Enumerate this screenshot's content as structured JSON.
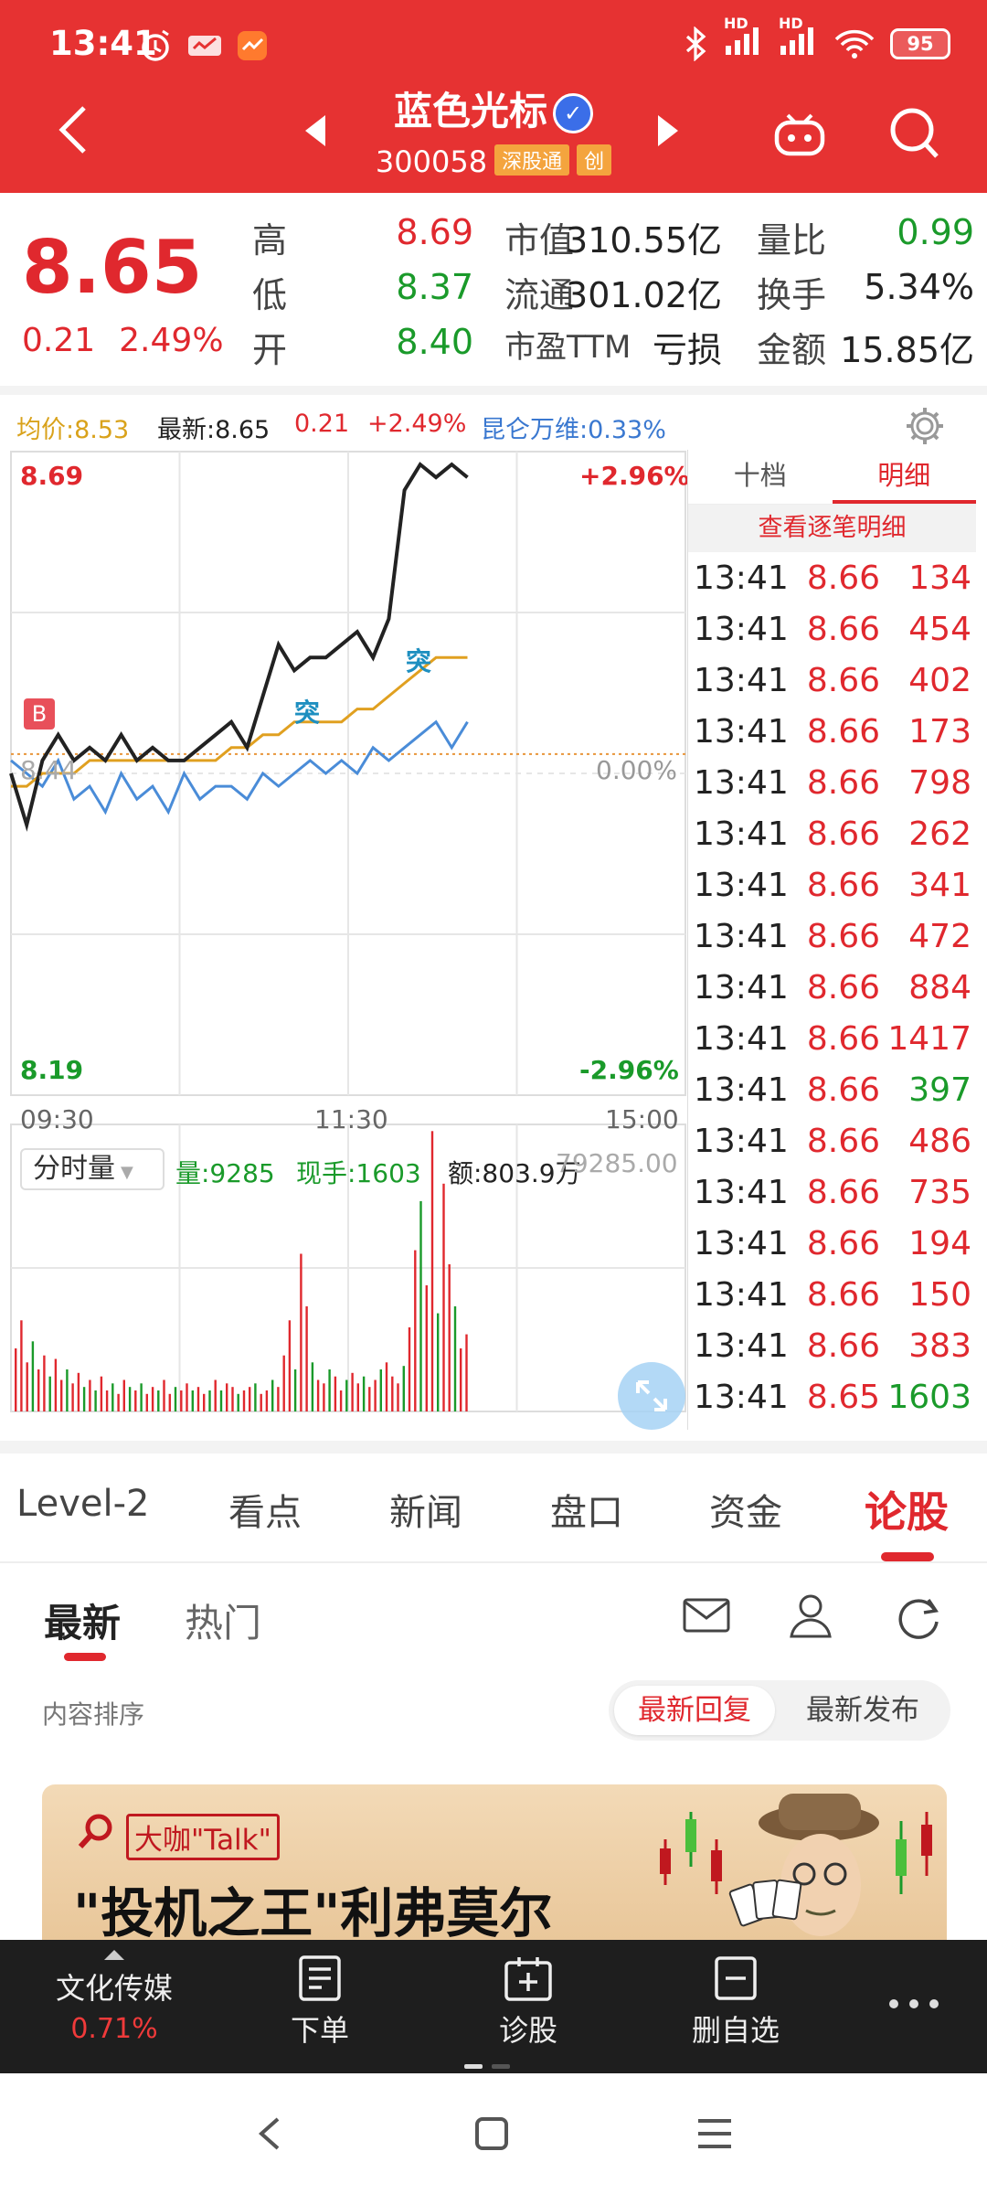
{
  "status_bar": {
    "time": "13:41",
    "battery": "95",
    "hd1": "HD",
    "hd2": "HD"
  },
  "header": {
    "title": "蓝色光标",
    "code": "300058",
    "tag_connect": "深股通",
    "tag_board": "创"
  },
  "quote": {
    "price": "8.65",
    "change": "0.21",
    "change_pct": "2.49%",
    "high_label": "高",
    "high": "8.69",
    "low_label": "低",
    "low": "8.37",
    "open_label": "开",
    "open": "8.40",
    "mcap_label": "市值",
    "mcap": "310.55亿",
    "float_label": "流通",
    "float": "301.02亿",
    "pe_label": "市盈TTM",
    "pe": "亏损",
    "vr_label": "量比",
    "vr": "0.99",
    "turnover_label": "换手",
    "turnover": "5.34%",
    "amount_label": "金额",
    "amount": "15.85亿"
  },
  "info_line": {
    "avg": "均价:8.53",
    "latest": "最新:8.65",
    "change": "0.21",
    "pct": "+2.49%",
    "index": "昆仑万维:0.33%"
  },
  "chart": {
    "y_top": "8.69",
    "y_bottom": "8.19",
    "pct_top": "+2.96%",
    "pct_bottom": "-2.96%",
    "pct_mid": "0.00%",
    "prev_close_label": "8.44",
    "x_labels": [
      "09:30",
      "11:30",
      "15:00"
    ],
    "marker_b": "B",
    "marker_tu1": "突",
    "marker_tu2": "突",
    "volume_selector": "分时量",
    "vol_text": "量:9285",
    "hand_text": "现手:1603",
    "amount_text": "额:803.9万",
    "vol_scale": "79285.00"
  },
  "chart_data": [
    {
      "type": "line",
      "title": "",
      "ylim": [
        8.19,
        8.69
      ],
      "x": [
        "09:30",
        "11:30",
        "15:00"
      ],
      "series": [
        {
          "name": "最新",
          "color": "#222222",
          "values": [
            8.44,
            8.4,
            8.45,
            8.47,
            8.45,
            8.46,
            8.45,
            8.47,
            8.45,
            8.46,
            8.45,
            8.45,
            8.46,
            8.47,
            8.48,
            8.46,
            8.5,
            8.54,
            8.52,
            8.53,
            8.53,
            8.54,
            8.55,
            8.53,
            8.56,
            8.66,
            8.68,
            8.67,
            8.68,
            8.67
          ]
        },
        {
          "name": "均价",
          "color": "#e0a020",
          "values": [
            8.43,
            8.43,
            8.44,
            8.44,
            8.44,
            8.45,
            8.45,
            8.45,
            8.45,
            8.45,
            8.45,
            8.45,
            8.45,
            8.45,
            8.46,
            8.46,
            8.47,
            8.47,
            8.48,
            8.48,
            8.48,
            8.48,
            8.49,
            8.49,
            8.5,
            8.51,
            8.52,
            8.53,
            8.53,
            8.53
          ]
        },
        {
          "name": "昆仑万维",
          "color": "#4a8cd8",
          "values": [
            8.45,
            8.44,
            8.43,
            8.45,
            8.42,
            8.43,
            8.41,
            8.44,
            8.42,
            8.43,
            8.41,
            8.44,
            8.42,
            8.43,
            8.43,
            8.42,
            8.44,
            8.43,
            8.44,
            8.45,
            8.44,
            8.45,
            8.44,
            8.46,
            8.45,
            8.46,
            8.47,
            8.48,
            8.46,
            8.48
          ]
        }
      ]
    },
    {
      "type": "bar",
      "title": "",
      "ylim": [
        0,
        79285
      ],
      "values": [
        18000,
        26000,
        14000,
        20000,
        12000,
        16000,
        10000,
        15000,
        9000,
        12000,
        8000,
        11000,
        7000,
        9000,
        6000,
        10000,
        6000,
        8000,
        5000,
        9000,
        7000,
        6000,
        8000,
        5000,
        7000,
        6000,
        9000,
        5000,
        7000,
        6000,
        8000,
        6000,
        7000,
        5000,
        6000,
        9000,
        6000,
        8000,
        7000,
        5000,
        6000,
        7000,
        8000,
        5000,
        6000,
        9000,
        7000,
        16000,
        26000,
        12000,
        45000,
        30000,
        14000,
        9000,
        8000,
        12000,
        10000,
        6000,
        9000,
        11000,
        8000,
        10000,
        7000,
        9000,
        12000,
        14000,
        10000,
        8000,
        13000,
        24000,
        46000,
        60000,
        36000,
        80000,
        28000,
        65000,
        42000,
        30000,
        18000,
        22000
      ],
      "colors": [
        "r",
        "r",
        "r",
        "g",
        "r",
        "r",
        "g",
        "r",
        "r",
        "g",
        "r",
        "r",
        "g",
        "r",
        "g",
        "r",
        "r",
        "g",
        "r",
        "r",
        "g",
        "r",
        "g",
        "r",
        "r",
        "g",
        "r",
        "r",
        "g",
        "r",
        "r",
        "g",
        "r",
        "r",
        "g",
        "r",
        "g",
        "r",
        "r",
        "g",
        "r",
        "r",
        "g",
        "r",
        "r",
        "g",
        "r",
        "r",
        "r",
        "g",
        "r",
        "r",
        "g",
        "r",
        "r",
        "g",
        "r",
        "r",
        "g",
        "r",
        "r",
        "g",
        "r",
        "r",
        "g",
        "r",
        "r",
        "r",
        "g",
        "r",
        "r",
        "g",
        "r",
        "r",
        "g",
        "r",
        "r",
        "g",
        "r",
        "r"
      ]
    }
  ],
  "detail": {
    "tab_ten": "十档",
    "tab_detail": "明细",
    "link": "查看逐笔明细",
    "rows": [
      {
        "t": "13:41",
        "p": "8.66",
        "v": "134",
        "c": "r"
      },
      {
        "t": "13:41",
        "p": "8.66",
        "v": "454",
        "c": "r"
      },
      {
        "t": "13:41",
        "p": "8.66",
        "v": "402",
        "c": "r"
      },
      {
        "t": "13:41",
        "p": "8.66",
        "v": "173",
        "c": "r"
      },
      {
        "t": "13:41",
        "p": "8.66",
        "v": "798",
        "c": "r"
      },
      {
        "t": "13:41",
        "p": "8.66",
        "v": "262",
        "c": "r"
      },
      {
        "t": "13:41",
        "p": "8.66",
        "v": "341",
        "c": "r"
      },
      {
        "t": "13:41",
        "p": "8.66",
        "v": "472",
        "c": "r"
      },
      {
        "t": "13:41",
        "p": "8.66",
        "v": "884",
        "c": "r"
      },
      {
        "t": "13:41",
        "p": "8.66",
        "v": "1417",
        "c": "r"
      },
      {
        "t": "13:41",
        "p": "8.66",
        "v": "397",
        "c": "g"
      },
      {
        "t": "13:41",
        "p": "8.66",
        "v": "486",
        "c": "r"
      },
      {
        "t": "13:41",
        "p": "8.66",
        "v": "735",
        "c": "r"
      },
      {
        "t": "13:41",
        "p": "8.66",
        "v": "194",
        "c": "r"
      },
      {
        "t": "13:41",
        "p": "8.66",
        "v": "150",
        "c": "r"
      },
      {
        "t": "13:41",
        "p": "8.66",
        "v": "383",
        "c": "r"
      },
      {
        "t": "13:41",
        "p": "8.65",
        "v": "1603",
        "c": "g"
      }
    ]
  },
  "main_tabs": [
    "Level-2",
    "看点",
    "新闻",
    "盘口",
    "资金",
    "论股"
  ],
  "sub_tabs": {
    "latest": "最新",
    "hot": "热门"
  },
  "sort": {
    "label": "内容排序",
    "opt1": "最新回复",
    "opt2": "最新发布"
  },
  "banner": {
    "tag": "大咖\"Talk\"",
    "title": "\"投机之王\"利弗莫尔"
  },
  "bottom_bar": {
    "sector": "文化传媒",
    "sector_pct": "0.71%",
    "order": "下单",
    "diagnose": "诊股",
    "remove": "删自选"
  },
  "colors": {
    "red": "#e63232",
    "green": "#1a9a2a",
    "blue": "#4a8cd8",
    "gold": "#e0a020"
  }
}
